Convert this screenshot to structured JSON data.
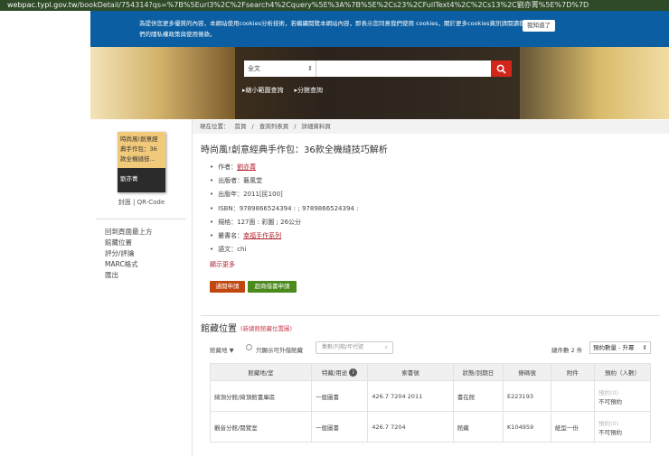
{
  "browser": {
    "url_host": "webpac.typl.gov.tw",
    "url_path": "/bookDetail/754314?qs=%7B%5Eurl3%2C%2Fsearch4%2Cquery%5E%3A%7B%5E%2Cs23%2CFullText4%2C%2Cs13%2C劉亦菁%5E%7D%7D"
  },
  "cookie": {
    "text": "為提供您更多優質的內容，本網站使用cookies分析技術，若繼續閱覽本網站內容，即表示您同意我們使用 cookies，關於更多cookies資訊請閱讀我們的隱私權政策與使用條款。",
    "button": "我知道了"
  },
  "search": {
    "field": "全文",
    "value": "",
    "links": [
      "縮小範圍查詢",
      "分館查詢"
    ]
  },
  "sidebar": {
    "cover_title": "時尚風!創意經典手作包：36款全機縫技...",
    "cover_author": "劉亦菁",
    "cover_links": "封面 | QR-Code",
    "nav": [
      "回到頁面最上方",
      "館藏位置",
      "評分/評論",
      "MARC格式",
      "匯出"
    ]
  },
  "breadcrumb": [
    "現在位置：",
    "首頁",
    "/",
    "查詢列表頁",
    "/",
    "詳細資料頁"
  ],
  "book": {
    "title": "時尚風!創意經典手作包：36款全機縫技巧解析",
    "meta": [
      {
        "label": "作者：",
        "value": "劉亦菁",
        "link": true
      },
      {
        "label": "出版者：",
        "value": "藝風堂"
      },
      {
        "label": "出版年：",
        "value": "2011[民100]"
      },
      {
        "label": "ISBN：",
        "value": "9789866524394 : ; 9789866524394 :"
      },
      {
        "label": "規格：",
        "value": "127面 : 彩圖 ; 26公分"
      },
      {
        "label": "叢書名：",
        "value": "幸福手作系列",
        "link": true
      },
      {
        "label": "語文：",
        "value": "chi"
      }
    ],
    "show_more": "顯示更多",
    "btn_reserve": "通閱申請",
    "btn_store": "超商借書申請"
  },
  "holdings": {
    "title": "館藏位置",
    "subtitle": "(新總館館藏位置圖)",
    "branch_filter": "館藏地",
    "only_available": "只顯示可外借館藏",
    "filter_placeholder": "集數/刊期/年代號",
    "total": "總件數 2 件",
    "sort": "預約數量 - 升冪",
    "headers": [
      "館藏地/室",
      "特藏/用途",
      "索書號",
      "狀態/到期日",
      "條碼號",
      "附件",
      "預約（人數）"
    ],
    "rows": [
      [
        "綺頂分館/綺頂館書庫區",
        "一般圖書",
        "426.7 7204 2011",
        "書在館",
        "E223193",
        "",
        "預約(0)",
        "不可預約"
      ],
      [
        "觀音分館/閱覽室",
        "一般圖書",
        "426.7 7204",
        "館藏",
        "K104959",
        "紙型一份",
        "預約(0)",
        "不可預約"
      ]
    ]
  }
}
